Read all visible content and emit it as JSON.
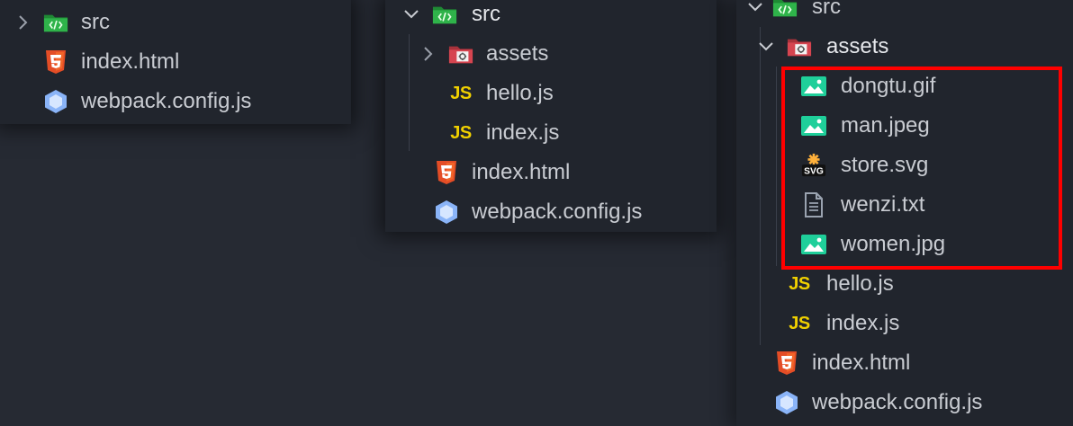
{
  "panels": [
    {
      "items": [
        {
          "label": "src",
          "icon": "folder-src-icon"
        },
        {
          "label": "index.html",
          "icon": "html5-icon"
        },
        {
          "label": "webpack.config.js",
          "icon": "webpack-icon"
        }
      ]
    },
    {
      "items": [
        {
          "label": "src",
          "icon": "folder-src-icon"
        },
        {
          "label": "assets",
          "icon": "folder-assets-icon"
        },
        {
          "label": "hello.js",
          "icon": "js-icon",
          "icon_text": "JS"
        },
        {
          "label": "index.js",
          "icon": "js-icon",
          "icon_text": "JS"
        },
        {
          "label": "index.html",
          "icon": "html5-icon"
        },
        {
          "label": "webpack.config.js",
          "icon": "webpack-icon"
        }
      ]
    },
    {
      "items": [
        {
          "label": "src",
          "icon": "folder-src-icon"
        },
        {
          "label": "assets",
          "icon": "folder-assets-icon"
        },
        {
          "label": "dongtu.gif",
          "icon": "image-icon"
        },
        {
          "label": "man.jpeg",
          "icon": "image-icon"
        },
        {
          "label": "store.svg",
          "icon": "svg-icon",
          "icon_text": "SVG"
        },
        {
          "label": "wenzi.txt",
          "icon": "text-file-icon"
        },
        {
          "label": "women.jpg",
          "icon": "image-icon"
        },
        {
          "label": "hello.js",
          "icon": "js-icon",
          "icon_text": "JS"
        },
        {
          "label": "index.js",
          "icon": "js-icon",
          "icon_text": "JS"
        },
        {
          "label": "index.html",
          "icon": "html5-icon"
        },
        {
          "label": "webpack.config.js",
          "icon": "webpack-icon"
        }
      ]
    }
  ],
  "colors": {
    "background": "#262a33",
    "panel": "#21252d",
    "highlight_border": "#ff0000",
    "js": "#f0d000",
    "html5": "#e44d26",
    "image": "#1fcf9a",
    "webpack": "#8ab4f8"
  }
}
